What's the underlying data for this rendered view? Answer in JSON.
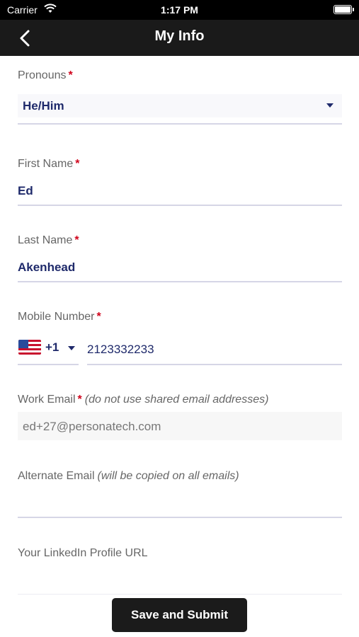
{
  "status_bar": {
    "carrier": "Carrier",
    "time": "1:17 PM"
  },
  "nav": {
    "title": "My Info"
  },
  "fields": {
    "pronouns": {
      "label": "Pronouns",
      "required": "*",
      "value": "He/Him"
    },
    "first_name": {
      "label": "First Name",
      "required": "*",
      "value": "Ed"
    },
    "last_name": {
      "label": "Last Name",
      "required": "*",
      "value": "Akenhead"
    },
    "mobile": {
      "label": "Mobile Number",
      "required": "*",
      "country_code": "+1",
      "value": "2123332233"
    },
    "work_email": {
      "label": "Work Email",
      "required": "*",
      "hint": "(do not use shared email addresses)",
      "value": "ed+27@personatech.com"
    },
    "alternate_email": {
      "label": "Alternate Email",
      "hint": "(will be copied on all emails)",
      "value": ""
    },
    "linkedin": {
      "label": "Your LinkedIn Profile URL",
      "value": ""
    }
  },
  "actions": {
    "submit_label": "Save and Submit"
  },
  "icons": {
    "back": "chevron-left-icon",
    "wifi": "wifi-icon",
    "battery": "battery-icon",
    "dropdown": "caret-down-icon",
    "flag": "us-flag-icon"
  },
  "colors": {
    "nav_bg": "#1a1a1a",
    "value_text": "#1f2a6b",
    "required": "#d0021b",
    "button_bg": "#1b1b1b"
  }
}
